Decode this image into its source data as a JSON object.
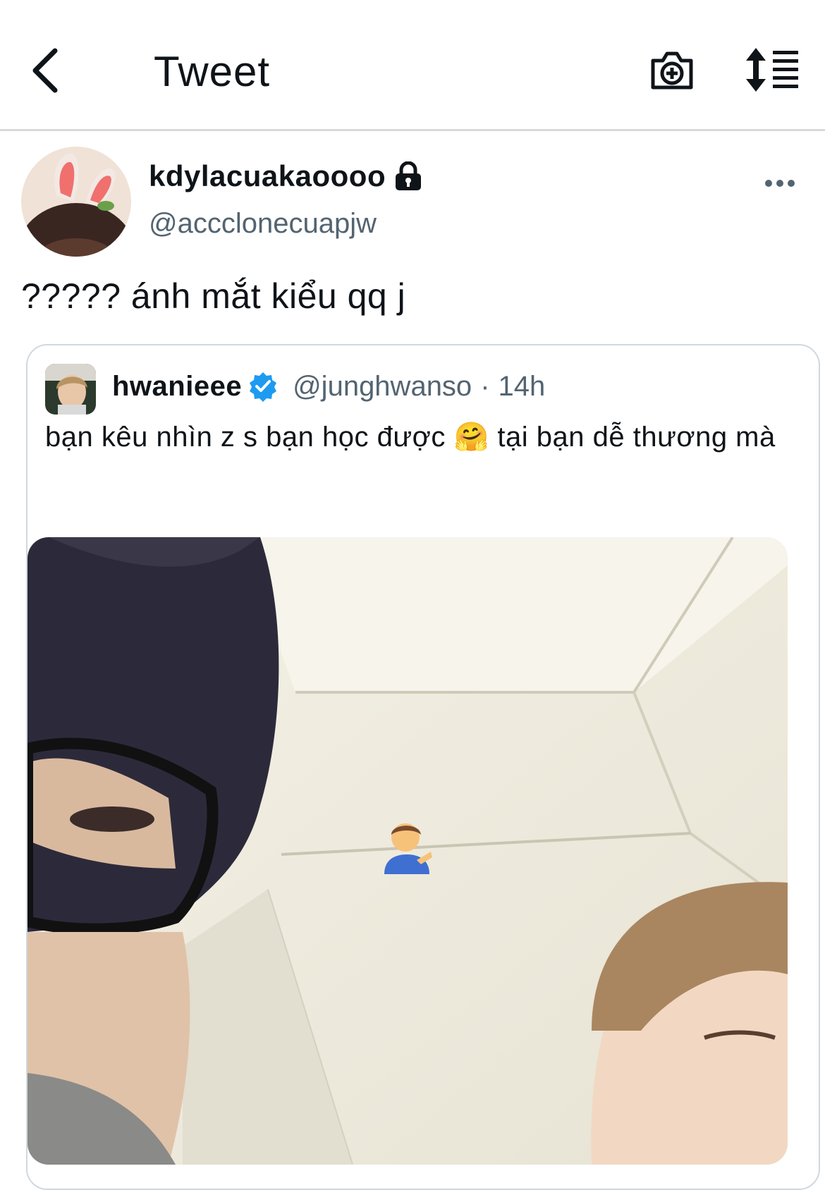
{
  "header": {
    "title": "Tweet",
    "back_icon": "chevron-left-icon",
    "camera_icon": "camera-plus-icon",
    "sort_icon": "sort-list-icon"
  },
  "tweet": {
    "display_name": "kdylacuakaoooo",
    "handle": "@accclonecuapjw",
    "locked": true,
    "text": "????? ánh mắt kiểu qq j"
  },
  "quoted": {
    "display_name": "hwanieee",
    "verified": true,
    "handle": "@junghwanso",
    "separator": "·",
    "time": "14h",
    "text": "bạn kêu nhìn z s bạn học được 🤗  tại bạn dễ thương mà",
    "media_overlay_emoji": "💁‍♂️"
  },
  "colors": {
    "text": "#0f1419",
    "secondary": "#536471",
    "verified": "#1d9bf0",
    "border": "#cfd9de"
  }
}
